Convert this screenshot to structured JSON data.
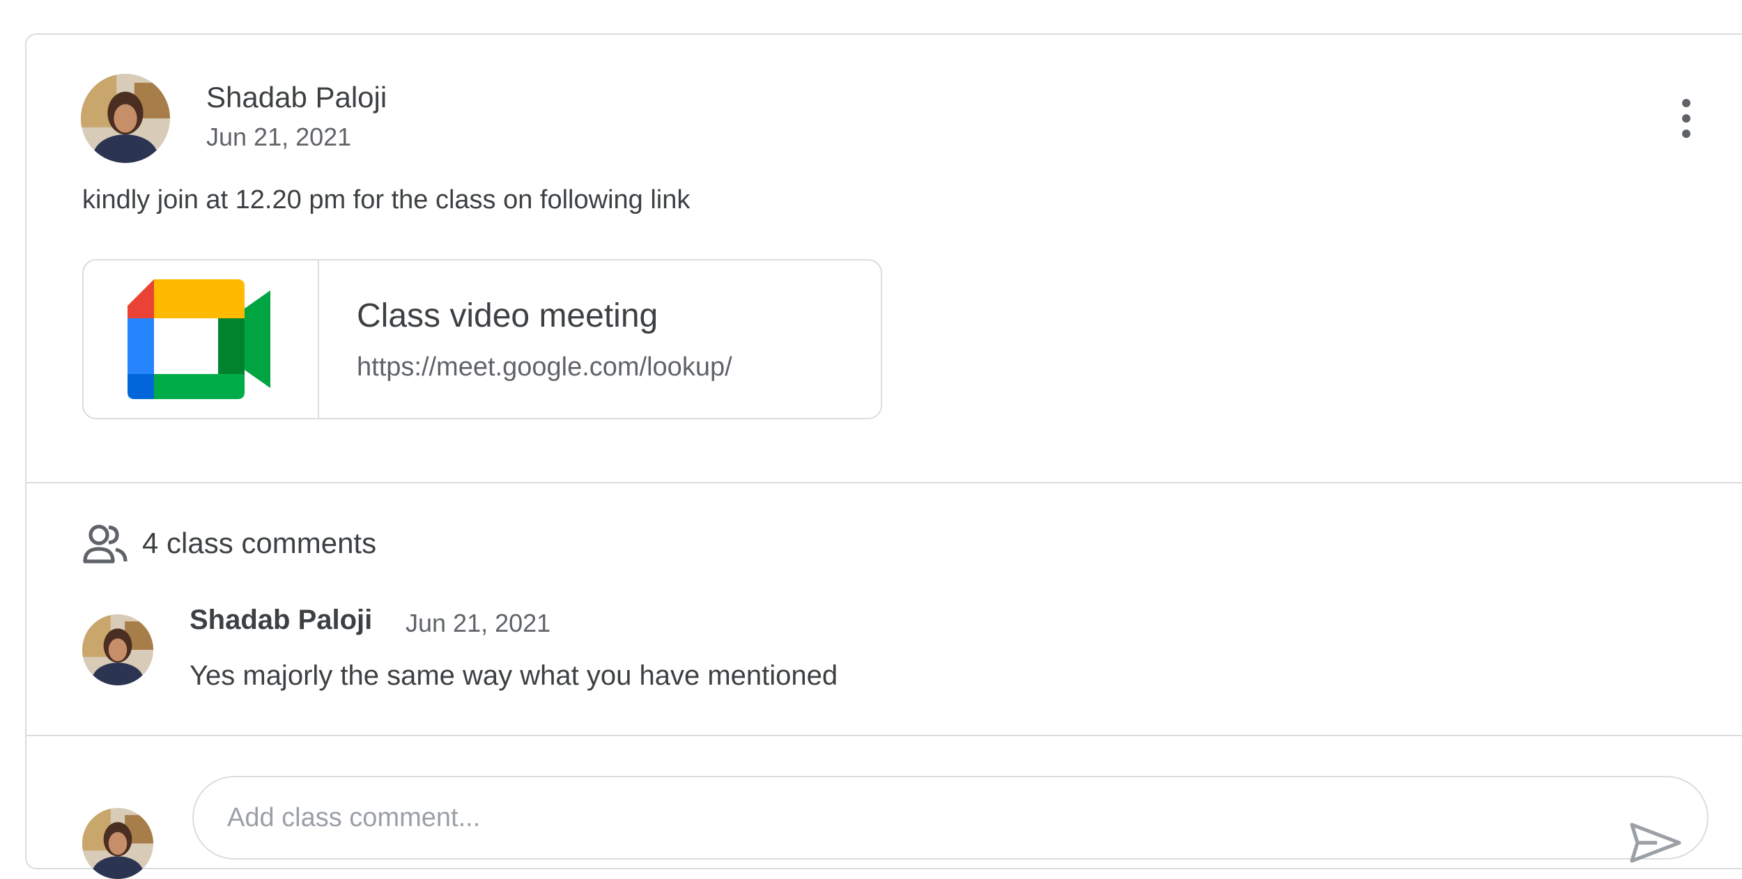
{
  "post": {
    "author": "Shadab Paloji",
    "date": "Jun 21, 2021",
    "body": "kindly join at 12.20 pm for the class on following link",
    "more_icon": "more-vert-icon",
    "attachment": {
      "title": "Class video meeting",
      "url": "https://meet.google.com/lookup/",
      "icon": "google-meet-icon"
    }
  },
  "comments": {
    "count_label": "4 class comments",
    "icon": "people-icon",
    "items": [
      {
        "author": "Shadab Paloji",
        "date": "Jun 21, 2021",
        "text": "Yes majorly the same way what you have mentioned"
      }
    ]
  },
  "composer": {
    "placeholder": "Add class comment...",
    "send_icon": "send-icon"
  },
  "colors": {
    "border": "#dadce0",
    "text": "#3c4043",
    "muted": "#5f6368",
    "meet_blue": "#2684fc",
    "meet_green": "#00ac47",
    "meet_yellow": "#ffba00",
    "meet_red": "#ea4335"
  }
}
